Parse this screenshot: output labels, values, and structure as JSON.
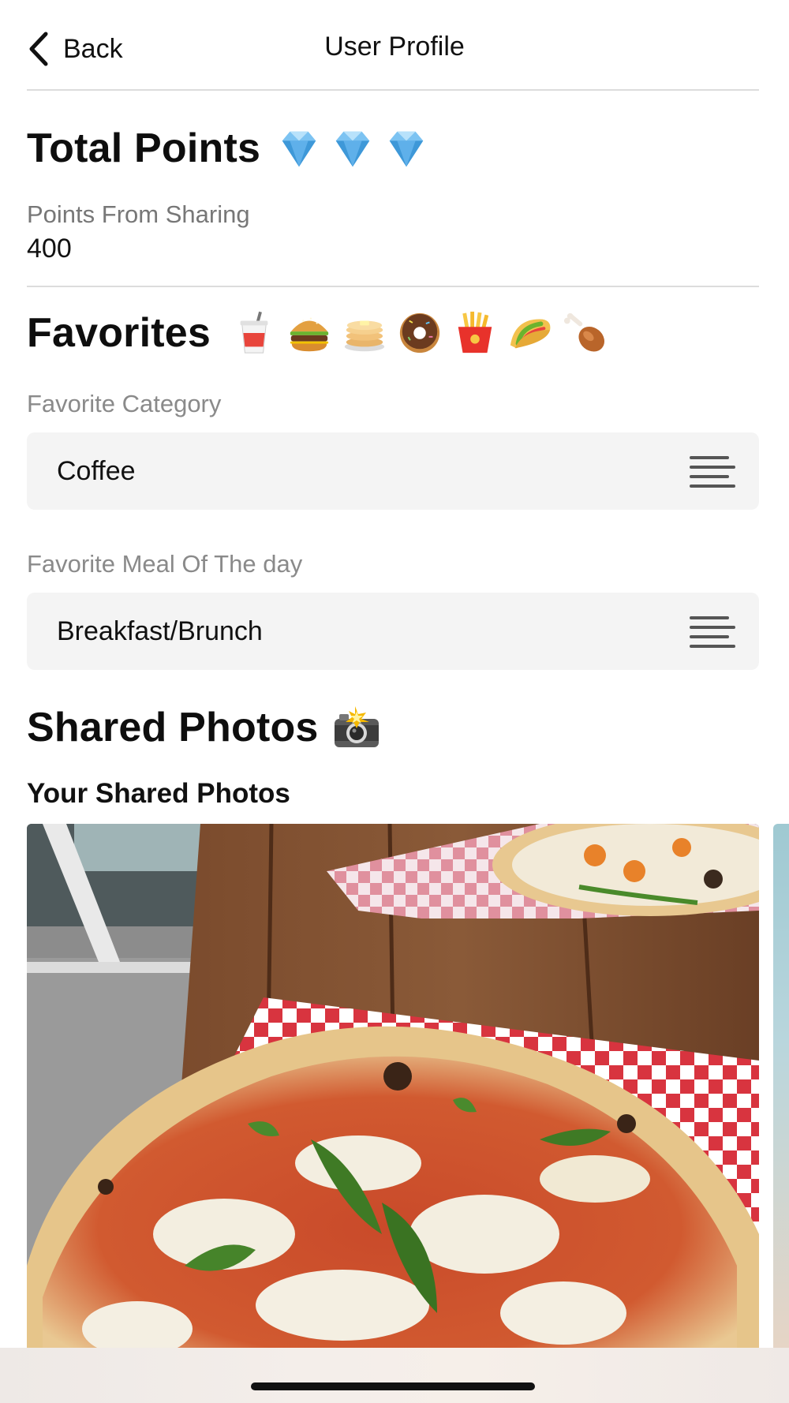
{
  "nav": {
    "back_label": "Back",
    "title": "User Profile"
  },
  "points": {
    "title": "Total Points",
    "title_emojis": [
      "gem-icon",
      "gem-icon",
      "gem-icon"
    ],
    "sharing_label": "Points From Sharing",
    "sharing_value": "400"
  },
  "favorites": {
    "title": "Favorites",
    "title_emojis": [
      "soda-cup-icon",
      "hamburger-icon",
      "pancakes-icon",
      "donut-icon",
      "fries-icon",
      "taco-icon",
      "chicken-leg-icon"
    ],
    "category": {
      "label": "Favorite Category",
      "value": "Coffee",
      "icon": "menu-lines-icon"
    },
    "meal": {
      "label": "Favorite Meal Of The day",
      "value": "Breakfast/Brunch",
      "icon": "menu-lines-icon"
    }
  },
  "photos": {
    "title": "Shared Photos",
    "title_emoji": "camera-flash-icon",
    "subtitle": "Your Shared Photos",
    "items": [
      {
        "subject": "pizza"
      },
      {
        "subject": "partial"
      }
    ]
  },
  "colors": {
    "divider": "#dcdcdc",
    "label_grey": "#8a8a8a",
    "select_bg": "#f4f4f4",
    "text": "#111111"
  }
}
